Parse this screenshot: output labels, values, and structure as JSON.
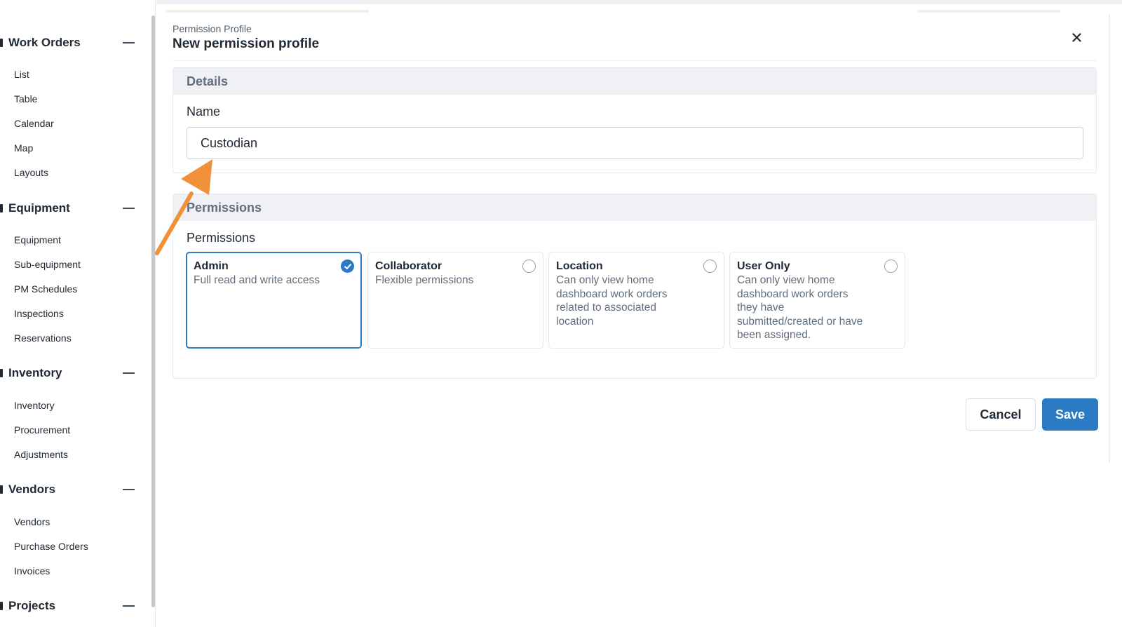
{
  "sidebar": {
    "sections": [
      {
        "title": "Work Orders",
        "items": [
          "List",
          "Table",
          "Calendar",
          "Map",
          "Layouts"
        ]
      },
      {
        "title": "Equipment",
        "items": [
          "Equipment",
          "Sub-equipment",
          "PM Schedules",
          "Inspections",
          "Reservations"
        ]
      },
      {
        "title": "Inventory",
        "items": [
          "Inventory",
          "Procurement",
          "Adjustments"
        ]
      },
      {
        "title": "Vendors",
        "items": [
          "Vendors",
          "Purchase Orders",
          "Invoices"
        ]
      },
      {
        "title": "Projects",
        "items": []
      }
    ]
  },
  "modal": {
    "eyebrow": "Permission Profile",
    "title": "New permission profile",
    "details": {
      "header": "Details",
      "name_label": "Name",
      "name_value": "Custodian"
    },
    "permissions": {
      "header": "Permissions",
      "label": "Permissions",
      "options": [
        {
          "title": "Admin",
          "desc": "Full read and write access",
          "selected": true
        },
        {
          "title": "Collaborator",
          "desc": "Flexible permissions",
          "selected": false
        },
        {
          "title": "Location",
          "desc": "Can only view home dashboard work orders related to associated location",
          "selected": false
        },
        {
          "title": "User Only",
          "desc": "Can only view home dashboard work orders they have submitted/created or have been assigned.",
          "selected": false
        }
      ]
    },
    "buttons": {
      "cancel": "Cancel",
      "save": "Save"
    }
  },
  "colors": {
    "accent": "#2b7bc4",
    "annotation": "#f0913a",
    "section_bg": "#eff1f4"
  },
  "icons": {
    "close": "close-icon",
    "collapse": "minus-icon",
    "selected": "check-circle-icon",
    "unselected": "radio-icon"
  }
}
